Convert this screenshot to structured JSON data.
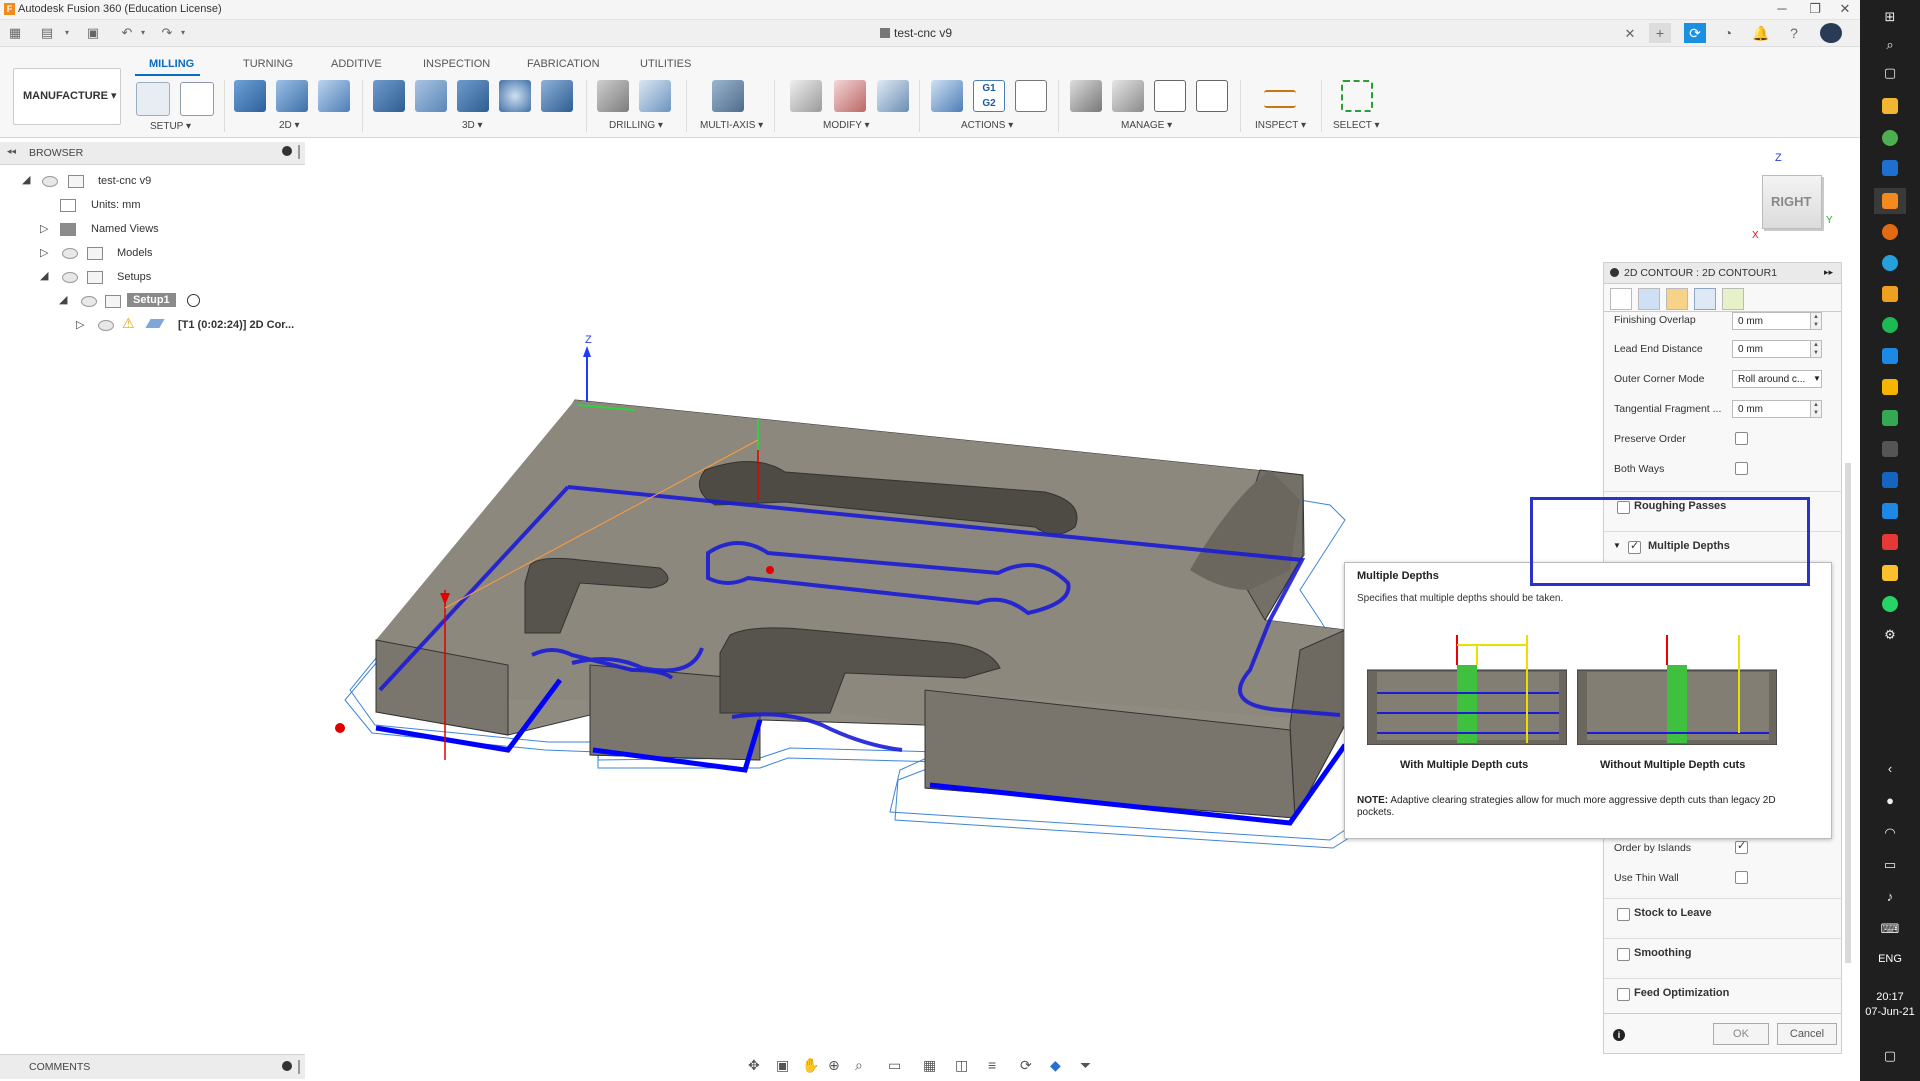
{
  "window": {
    "title": "Autodesk Fusion 360 (Education License)",
    "minimize": "─",
    "maximize": "❐",
    "close": "✕"
  },
  "document": {
    "title": "test-cnc v9"
  },
  "workspace": {
    "label": "MANUFACTURE ▾"
  },
  "ribbon": {
    "tabs": [
      "MILLING",
      "TURNING",
      "ADDITIVE",
      "INSPECTION",
      "FABRICATION",
      "UTILITIES"
    ],
    "groups": [
      "SETUP ▾",
      "2D ▾",
      "3D ▾",
      "DRILLING ▾",
      "MULTI-AXIS ▾",
      "MODIFY ▾",
      "ACTIONS ▾",
      "MANAGE ▾",
      "INSPECT ▾",
      "SELECT ▾"
    ]
  },
  "browser": {
    "header": "BROWSER",
    "nodes": {
      "root": "test-cnc v9",
      "units": "Units: mm",
      "named_views": "Named Views",
      "models": "Models",
      "setups": "Setups",
      "setup1": "Setup1",
      "operation": "[T1 (0:02:24)] 2D Cor..."
    }
  },
  "viewcube": {
    "face": "RIGHT",
    "axis_z": "Z",
    "axis_x": "X",
    "axis_y": "Y"
  },
  "viewport": {
    "axis_z": "Z"
  },
  "props": {
    "title": "2D CONTOUR : 2D CONTOUR1",
    "rows": {
      "finishing_overlap": {
        "label": "Finishing Overlap",
        "value": "0 mm"
      },
      "lead_end_distance": {
        "label": "Lead End Distance",
        "value": "0 mm"
      },
      "outer_corner_mode": {
        "label": "Outer Corner Mode",
        "value": "Roll around c..."
      },
      "tangential_fragment": {
        "label": "Tangential Fragment ...",
        "value": "0 mm"
      },
      "preserve_order": {
        "label": "Preserve Order",
        "checked": false
      },
      "both_ways": {
        "label": "Both Ways",
        "checked": false
      },
      "order_by_islands": {
        "label": "Order by Islands",
        "checked": true
      },
      "use_thin_wall": {
        "label": "Use Thin Wall",
        "checked": false
      }
    },
    "sections": {
      "roughing_passes": {
        "label": "Roughing Passes",
        "checked": false
      },
      "multiple_depths": {
        "label": "Multiple Depths",
        "checked": true
      },
      "stock_to_leave": {
        "label": "Stock to Leave",
        "checked": false
      },
      "smoothing": {
        "label": "Smoothing",
        "checked": false
      },
      "feed_optimization": {
        "label": "Feed Optimization",
        "checked": false
      }
    },
    "ok": "OK",
    "cancel": "Cancel"
  },
  "tooltip": {
    "title": "Multiple Depths",
    "desc": "Specifies that multiple depths should be taken.",
    "caption_left": "With Multiple Depth cuts",
    "caption_right": "Without Multiple Depth cuts",
    "note_label": "NOTE:",
    "note": "Adaptive clearing strategies allow for much more aggressive depth cuts than legacy 2D pockets."
  },
  "comments": {
    "label": "COMMENTS"
  },
  "taskbar": {
    "lang": "ENG",
    "time": "20:17",
    "date": "07-Jun-21"
  },
  "colors": {
    "accent": "#0a6cc2",
    "toolpath": "#1c1cd6",
    "highlight_box": "#2a33c9",
    "part_top": "#8c887e"
  }
}
